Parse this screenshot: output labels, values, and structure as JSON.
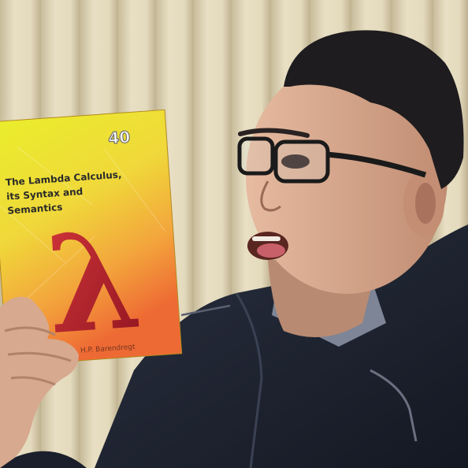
{
  "book": {
    "series_number": "40",
    "title_line1": "The Lambda Calculus,",
    "title_line2": "its Syntax and",
    "title_line3": "Semantics",
    "symbol": "λ",
    "author": "H.P. Barendregt"
  },
  "colors": {
    "blinds_light": "#e6dcc0",
    "blinds_dark": "#c9bd9c",
    "cover_yellow": "#ecec2a",
    "cover_orange": "#f07a34",
    "lambda_red": "#c2242a",
    "jacket": "#1d2230",
    "skin": "#d6a98c",
    "hair": "#1c1a1c"
  }
}
